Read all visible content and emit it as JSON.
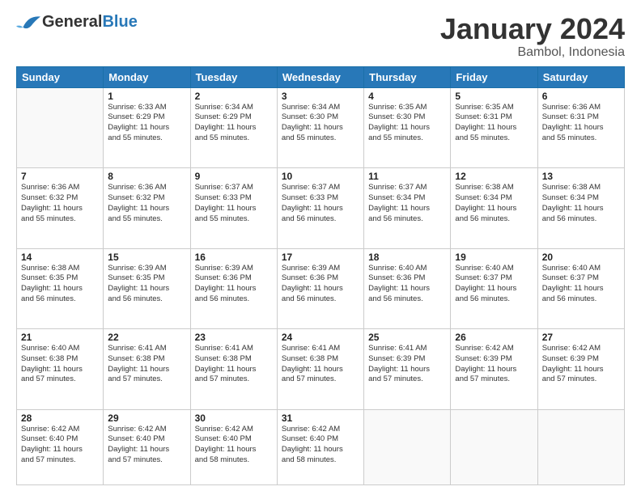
{
  "logo": {
    "general": "General",
    "blue": "Blue"
  },
  "title": "January 2024",
  "subtitle": "Bambol, Indonesia",
  "days_header": [
    "Sunday",
    "Monday",
    "Tuesday",
    "Wednesday",
    "Thursday",
    "Friday",
    "Saturday"
  ],
  "weeks": [
    [
      {
        "day": "",
        "info": ""
      },
      {
        "day": "1",
        "info": "Sunrise: 6:33 AM\nSunset: 6:29 PM\nDaylight: 11 hours\nand 55 minutes."
      },
      {
        "day": "2",
        "info": "Sunrise: 6:34 AM\nSunset: 6:29 PM\nDaylight: 11 hours\nand 55 minutes."
      },
      {
        "day": "3",
        "info": "Sunrise: 6:34 AM\nSunset: 6:30 PM\nDaylight: 11 hours\nand 55 minutes."
      },
      {
        "day": "4",
        "info": "Sunrise: 6:35 AM\nSunset: 6:30 PM\nDaylight: 11 hours\nand 55 minutes."
      },
      {
        "day": "5",
        "info": "Sunrise: 6:35 AM\nSunset: 6:31 PM\nDaylight: 11 hours\nand 55 minutes."
      },
      {
        "day": "6",
        "info": "Sunrise: 6:36 AM\nSunset: 6:31 PM\nDaylight: 11 hours\nand 55 minutes."
      }
    ],
    [
      {
        "day": "7",
        "info": "Sunrise: 6:36 AM\nSunset: 6:32 PM\nDaylight: 11 hours\nand 55 minutes."
      },
      {
        "day": "8",
        "info": "Sunrise: 6:36 AM\nSunset: 6:32 PM\nDaylight: 11 hours\nand 55 minutes."
      },
      {
        "day": "9",
        "info": "Sunrise: 6:37 AM\nSunset: 6:33 PM\nDaylight: 11 hours\nand 55 minutes."
      },
      {
        "day": "10",
        "info": "Sunrise: 6:37 AM\nSunset: 6:33 PM\nDaylight: 11 hours\nand 56 minutes."
      },
      {
        "day": "11",
        "info": "Sunrise: 6:37 AM\nSunset: 6:34 PM\nDaylight: 11 hours\nand 56 minutes."
      },
      {
        "day": "12",
        "info": "Sunrise: 6:38 AM\nSunset: 6:34 PM\nDaylight: 11 hours\nand 56 minutes."
      },
      {
        "day": "13",
        "info": "Sunrise: 6:38 AM\nSunset: 6:34 PM\nDaylight: 11 hours\nand 56 minutes."
      }
    ],
    [
      {
        "day": "14",
        "info": "Sunrise: 6:38 AM\nSunset: 6:35 PM\nDaylight: 11 hours\nand 56 minutes."
      },
      {
        "day": "15",
        "info": "Sunrise: 6:39 AM\nSunset: 6:35 PM\nDaylight: 11 hours\nand 56 minutes."
      },
      {
        "day": "16",
        "info": "Sunrise: 6:39 AM\nSunset: 6:36 PM\nDaylight: 11 hours\nand 56 minutes."
      },
      {
        "day": "17",
        "info": "Sunrise: 6:39 AM\nSunset: 6:36 PM\nDaylight: 11 hours\nand 56 minutes."
      },
      {
        "day": "18",
        "info": "Sunrise: 6:40 AM\nSunset: 6:36 PM\nDaylight: 11 hours\nand 56 minutes."
      },
      {
        "day": "19",
        "info": "Sunrise: 6:40 AM\nSunset: 6:37 PM\nDaylight: 11 hours\nand 56 minutes."
      },
      {
        "day": "20",
        "info": "Sunrise: 6:40 AM\nSunset: 6:37 PM\nDaylight: 11 hours\nand 56 minutes."
      }
    ],
    [
      {
        "day": "21",
        "info": "Sunrise: 6:40 AM\nSunset: 6:38 PM\nDaylight: 11 hours\nand 57 minutes."
      },
      {
        "day": "22",
        "info": "Sunrise: 6:41 AM\nSunset: 6:38 PM\nDaylight: 11 hours\nand 57 minutes."
      },
      {
        "day": "23",
        "info": "Sunrise: 6:41 AM\nSunset: 6:38 PM\nDaylight: 11 hours\nand 57 minutes."
      },
      {
        "day": "24",
        "info": "Sunrise: 6:41 AM\nSunset: 6:38 PM\nDaylight: 11 hours\nand 57 minutes."
      },
      {
        "day": "25",
        "info": "Sunrise: 6:41 AM\nSunset: 6:39 PM\nDaylight: 11 hours\nand 57 minutes."
      },
      {
        "day": "26",
        "info": "Sunrise: 6:42 AM\nSunset: 6:39 PM\nDaylight: 11 hours\nand 57 minutes."
      },
      {
        "day": "27",
        "info": "Sunrise: 6:42 AM\nSunset: 6:39 PM\nDaylight: 11 hours\nand 57 minutes."
      }
    ],
    [
      {
        "day": "28",
        "info": "Sunrise: 6:42 AM\nSunset: 6:40 PM\nDaylight: 11 hours\nand 57 minutes."
      },
      {
        "day": "29",
        "info": "Sunrise: 6:42 AM\nSunset: 6:40 PM\nDaylight: 11 hours\nand 57 minutes."
      },
      {
        "day": "30",
        "info": "Sunrise: 6:42 AM\nSunset: 6:40 PM\nDaylight: 11 hours\nand 58 minutes."
      },
      {
        "day": "31",
        "info": "Sunrise: 6:42 AM\nSunset: 6:40 PM\nDaylight: 11 hours\nand 58 minutes."
      },
      {
        "day": "",
        "info": ""
      },
      {
        "day": "",
        "info": ""
      },
      {
        "day": "",
        "info": ""
      }
    ]
  ]
}
